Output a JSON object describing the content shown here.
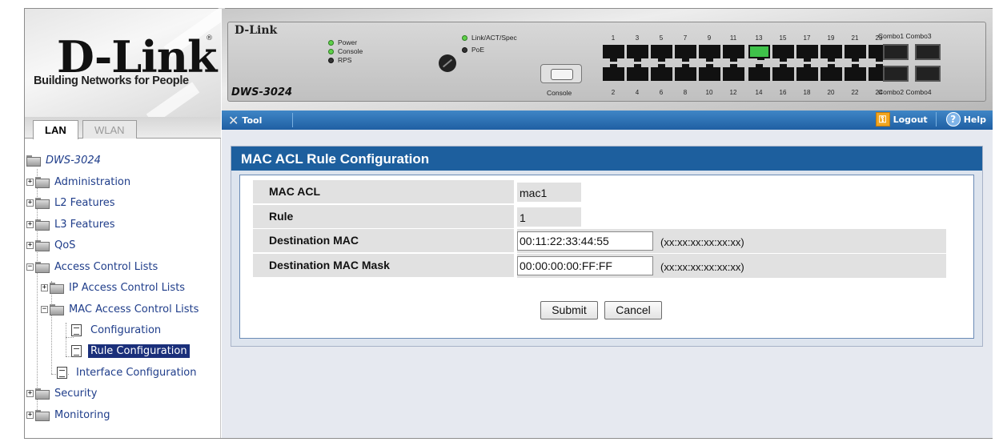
{
  "logo": {
    "brand": "D-Link",
    "registered": "®",
    "tagline": "Building Networks for People"
  },
  "nav_tabs": [
    {
      "label": "LAN",
      "active": true
    },
    {
      "label": "WLAN",
      "active": false
    }
  ],
  "tree": {
    "root": "DWS-3024",
    "items": [
      {
        "label": "Administration"
      },
      {
        "label": "L2 Features"
      },
      {
        "label": "L3 Features"
      },
      {
        "label": "QoS"
      },
      {
        "label": "Access Control Lists"
      },
      {
        "label": "IP Access Control Lists"
      },
      {
        "label": "MAC Access Control Lists"
      },
      {
        "label": "Configuration"
      },
      {
        "label": "Rule Configuration",
        "selected": true
      },
      {
        "label": "Interface Configuration"
      },
      {
        "label": "Security"
      },
      {
        "label": "Monitoring"
      }
    ]
  },
  "device": {
    "brand": "D-Link",
    "model": "DWS-3024",
    "leds": {
      "power": "Power",
      "console": "Console",
      "rps": "RPS",
      "link": "Link/ACT/Spec",
      "poe": "PoE"
    },
    "console_label": "Console",
    "top_port_numbers": [
      "1",
      "3",
      "5",
      "7",
      "9",
      "11",
      "13",
      "15",
      "17",
      "19",
      "21",
      "23"
    ],
    "bottom_port_numbers": [
      "2",
      "4",
      "6",
      "8",
      "10",
      "12",
      "14",
      "16",
      "18",
      "20",
      "22",
      "24"
    ],
    "combo_top": "Combo1 Combo3",
    "combo_bottom": "Combo2 Combo4"
  },
  "toolbar": {
    "tool_label": "Tool",
    "logout_label": "Logout",
    "help_label": "Help"
  },
  "page": {
    "title": "MAC ACL Rule Configuration",
    "rows": {
      "mac_acl": {
        "label": "MAC ACL",
        "value": "mac1"
      },
      "rule": {
        "label": "Rule",
        "value": "1"
      },
      "dest_mac": {
        "label": "Destination MAC",
        "value": "00:11:22:33:44:55",
        "hint": "(xx:xx:xx:xx:xx:xx)"
      },
      "dest_mac_mask": {
        "label": "Destination MAC Mask",
        "value": "00:00:00:00:FF:FF",
        "hint": "(xx:xx:xx:xx:xx:xx)"
      }
    },
    "submit_label": "Submit",
    "cancel_label": "Cancel"
  },
  "colors": {
    "header_blue": "#1d5f9e",
    "toolbar_blue": "#2f73b8",
    "nav_text": "#1f3d8a",
    "selected_bg": "#1a2f7a",
    "content_bg": "#e6e9f0"
  }
}
